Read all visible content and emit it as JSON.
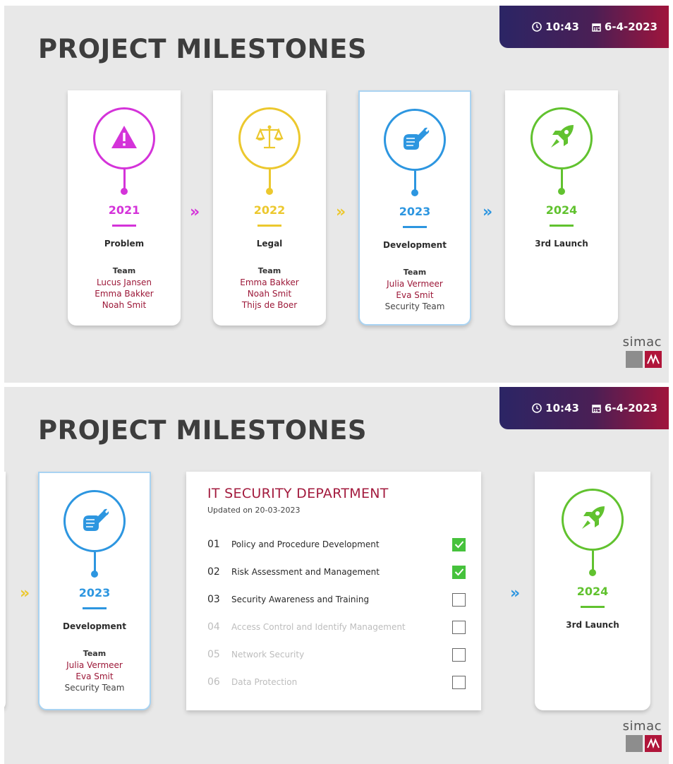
{
  "header": {
    "time": "10:43",
    "date": "6-4-2023"
  },
  "page_title": "PROJECT MILESTONES",
  "milestones": [
    {
      "year": "2021",
      "label": "Problem",
      "color": "#d433d9",
      "icon": "warning-icon",
      "team_heading": "Team",
      "team": [
        "Lucus Jansen",
        "Emma Bakker",
        "Noah Smit"
      ]
    },
    {
      "year": "2022",
      "label": "Legal",
      "color": "#ecc82e",
      "icon": "scales-icon",
      "team_heading": "Team",
      "team": [
        "Emma Bakker",
        "Noah Smit",
        "Thijs de Boer"
      ]
    },
    {
      "year": "2023",
      "label": "Development",
      "color": "#2d96e0",
      "icon": "fix-hand-icon",
      "team_heading": "Team",
      "team": [
        "Julia Vermeer",
        "Eva Smit",
        "Security Team"
      ]
    },
    {
      "year": "2024",
      "label": "3rd Launch",
      "color": "#61c22f",
      "icon": "rocket-icon",
      "team_heading": "",
      "team": []
    }
  ],
  "department": {
    "title": "IT SECURITY DEPARTMENT",
    "updated": "Updated on 20-03-2023",
    "tasks": [
      {
        "num": "01",
        "name": "Policy and Procedure Development",
        "done": true,
        "active": true
      },
      {
        "num": "02",
        "name": "Risk Assessment and Management",
        "done": true,
        "active": true
      },
      {
        "num": "03",
        "name": "Security Awareness and Training",
        "done": false,
        "active": true
      },
      {
        "num": "04",
        "name": "Access Control and Identify Management",
        "done": false,
        "active": false
      },
      {
        "num": "05",
        "name": "Network Security",
        "done": false,
        "active": false
      },
      {
        "num": "06",
        "name": "Data Protection",
        "done": false,
        "active": false
      }
    ]
  },
  "logo": {
    "word": "simac"
  },
  "colors": {
    "accent": "#a31b3e",
    "bar_start": "#2b2565",
    "bar_end": "#a0143c"
  }
}
